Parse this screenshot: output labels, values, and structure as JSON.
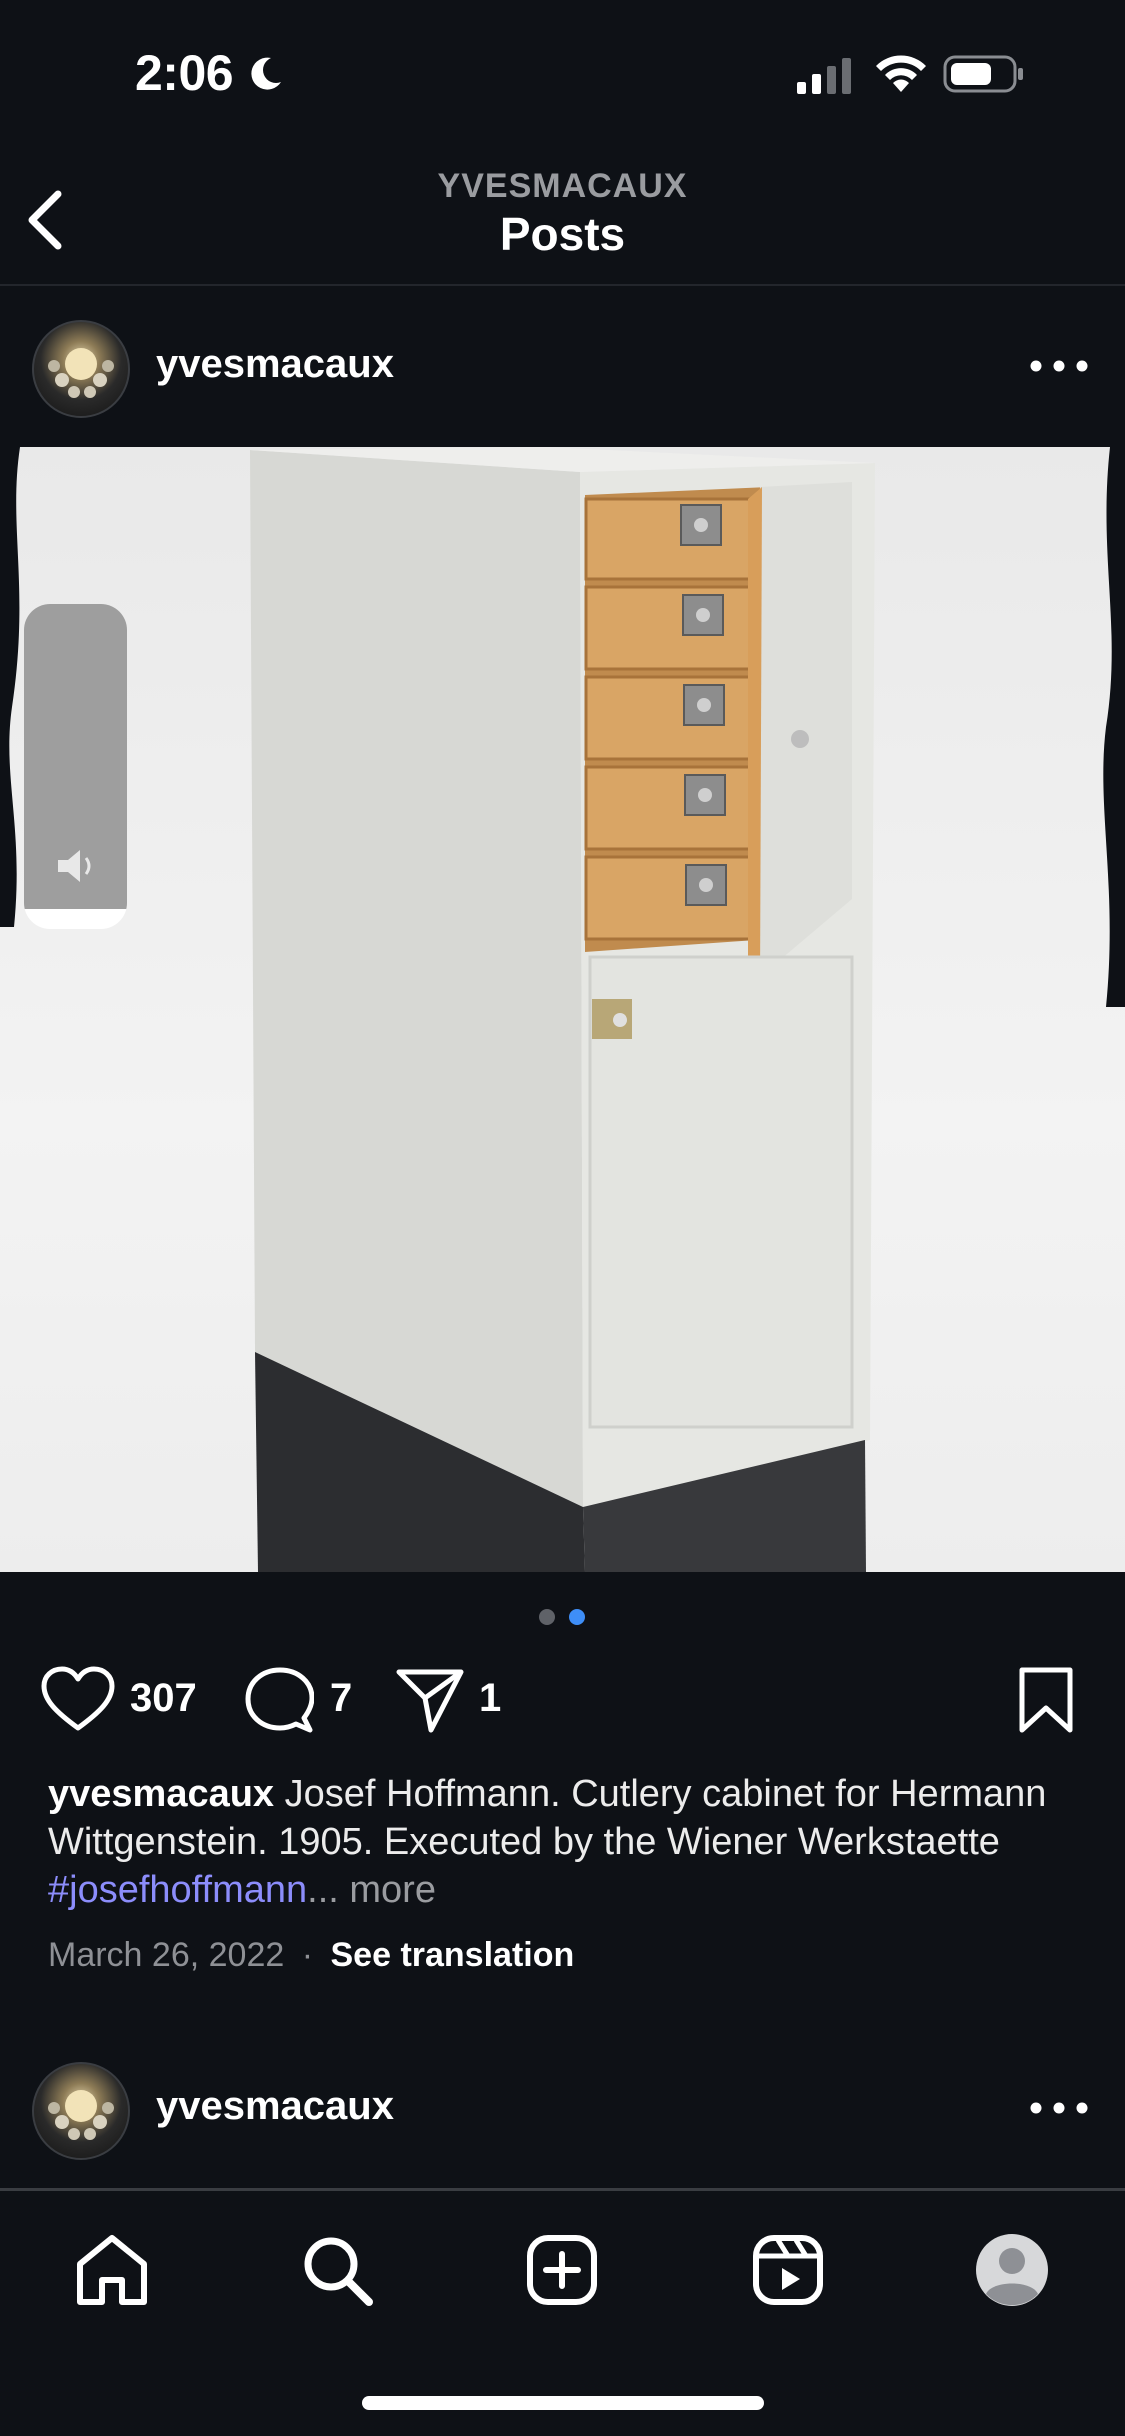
{
  "status_bar": {
    "time": "2:06",
    "icons": [
      "moon-icon",
      "signal-icon",
      "wifi-icon",
      "battery-icon"
    ]
  },
  "header": {
    "account": "YVESMACAUX",
    "title": "Posts",
    "back_icon": "chevron-left-icon"
  },
  "post": {
    "username": "yvesmacaux",
    "image_alt": "Josef Hoffmann cutlery cabinet",
    "carousel": {
      "total": 2,
      "active": 2
    },
    "likes": "307",
    "comments": "7",
    "shares": "1",
    "caption": {
      "username": "yvesmacaux",
      "text": " Josef Hoffmann. Cutlery cabinet for Hermann Wittgenstein. 1905. Executed by the Wiener Werkstaette ",
      "hashtag": "#josefhoffmann",
      "more": "... more"
    },
    "date": "March 26, 2022",
    "separator": "·",
    "see_translation": "See translation"
  },
  "next_post": {
    "username": "yvesmacaux"
  },
  "tab_bar": {
    "items": [
      "home-icon",
      "search-icon",
      "create-icon",
      "reels-icon",
      "profile-icon"
    ]
  },
  "colors": {
    "background": "#0e1116",
    "hashtag": "#8c8dfb",
    "carousel_active": "#3e8ef7",
    "carousel_inactive": "#5f6268"
  }
}
